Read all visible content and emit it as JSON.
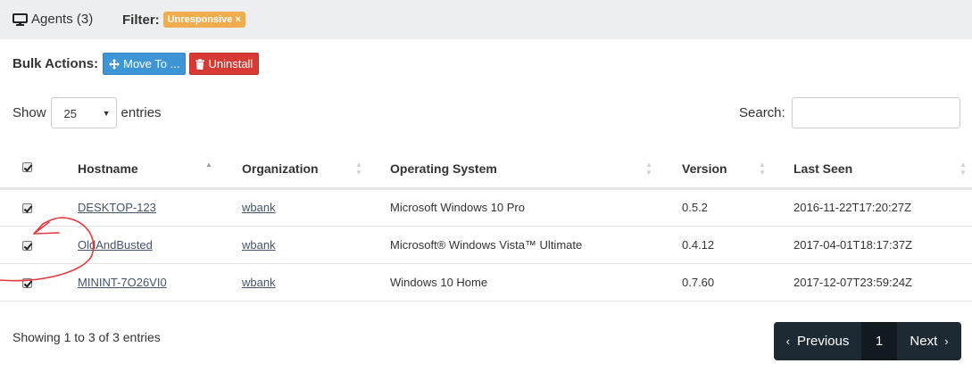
{
  "header": {
    "agents_label": "Agents (3)",
    "filter_label": "Filter:",
    "filter_badge": "Unresponsive ×"
  },
  "bulk": {
    "label": "Bulk Actions:",
    "move_label": "Move To ...",
    "uninstall_label": "Uninstall"
  },
  "length": {
    "show_label": "Show",
    "selected": "25",
    "entries_label": "entries"
  },
  "search": {
    "label": "Search:",
    "value": ""
  },
  "table": {
    "columns": [
      "Hostname",
      "Organization",
      "Operating System",
      "Version",
      "Last Seen"
    ],
    "rows": [
      {
        "checked": true,
        "hostname": "DESKTOP-123",
        "organization": "wbank",
        "os": "Microsoft Windows 10 Pro",
        "version": "0.5.2",
        "last_seen": "2016-11-22T17:20:27Z"
      },
      {
        "checked": true,
        "hostname": "OldAndBusted",
        "organization": "wbank",
        "os": "Microsoft® Windows Vista™ Ultimate",
        "version": "0.4.12",
        "last_seen": "2017-04-01T18:17:37Z"
      },
      {
        "checked": true,
        "hostname": "MININT-7O26VI0",
        "organization": "wbank",
        "os": "Windows 10 Home",
        "version": "0.7.60",
        "last_seen": "2017-12-07T23:59:24Z"
      }
    ]
  },
  "footer": {
    "info": "Showing 1 to 3 of 3 entries",
    "prev_label": "Previous",
    "current_page": "1",
    "next_label": "Next"
  },
  "colors": {
    "filter_badge": "#f0ad4e",
    "move_button": "#3e95d6",
    "uninstall_button": "#d63a33",
    "pager": "#1e2a33",
    "annotation": "#e0393e"
  }
}
